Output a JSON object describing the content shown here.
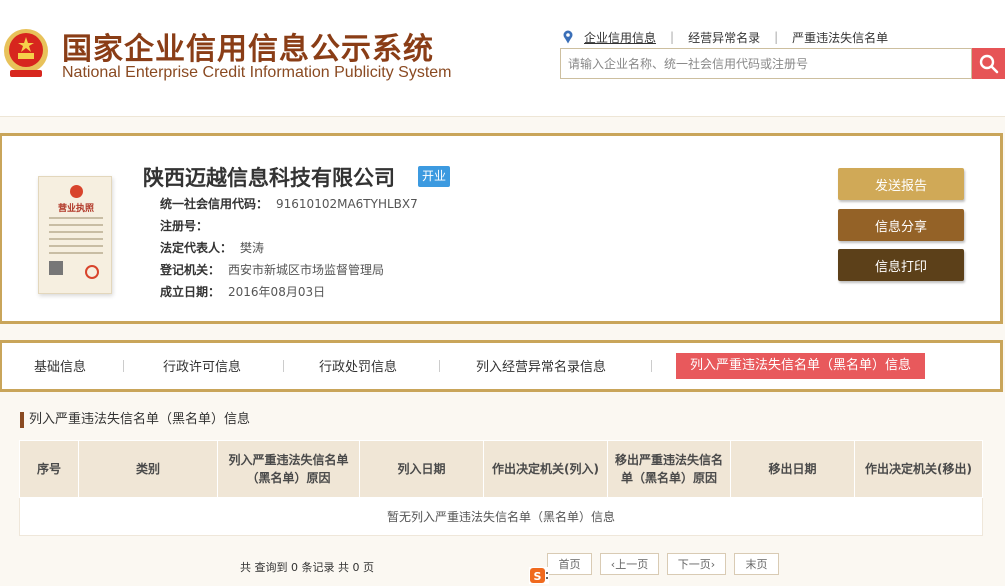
{
  "header": {
    "title_cn": "国家企业信用信息公示系统",
    "title_en": "National Enterprise Credit Information Publicity System",
    "emblem_icon": "national-emblem-icon",
    "nav": [
      {
        "label": "企业信用信息",
        "active": true
      },
      {
        "label": "经营异常名录",
        "active": false
      },
      {
        "label": "严重违法失信名单",
        "active": false
      }
    ],
    "search_placeholder": "请输入企业名称、统一社会信用代码或注册号",
    "search_icon": "search-icon"
  },
  "company": {
    "name": "陕西迈越信息科技有限公司",
    "status": "开业",
    "license_image_title": "营业执照",
    "fields": [
      {
        "label": "统一社会信用代码：",
        "value": "91610102MA6TYHLBX7"
      },
      {
        "label": "注册号：",
        "value": ""
      },
      {
        "label": "法定代表人：",
        "value": "樊涛"
      },
      {
        "label": "登记机关：",
        "value": "西安市新城区市场监督管理局"
      },
      {
        "label": "成立日期：",
        "value": "2016年08月03日"
      }
    ]
  },
  "actions": [
    {
      "label": "发送报告",
      "color": "#d0a957"
    },
    {
      "label": "信息分享",
      "color": "#946227"
    },
    {
      "label": "信息打印",
      "color": "#5c4019"
    }
  ],
  "tabs": [
    {
      "label": "基础信息",
      "active": false
    },
    {
      "label": "行政许可信息",
      "active": false
    },
    {
      "label": "行政处罚信息",
      "active": false
    },
    {
      "label": "列入经营异常名录信息",
      "active": false
    },
    {
      "label": "列入严重违法失信名单（黑名单）信息",
      "active": true
    }
  ],
  "section": {
    "title": "列入严重违法失信名单（黑名单）信息",
    "columns": [
      "序号",
      "类别",
      "列入严重违法失信名单（黑名单）原因",
      "列入日期",
      "作出决定机关(列入)",
      "移出严重违法失信名单（黑名单）原因",
      "移出日期",
      "作出决定机关(移出)"
    ],
    "empty_message": "暂无列入严重违法失信名单（黑名单）信息"
  },
  "pagination": {
    "summary": "共 查询到 0 条记录 共 0 页",
    "buttons": [
      "首页",
      "上一页",
      "下一页",
      "末页"
    ]
  },
  "colors": {
    "brand_brown": "#8a3d16",
    "gold_border": "#c9a55a",
    "active_tab": "#e8595c",
    "status_badge": "#3c9ae0",
    "search_button": "#e65456"
  }
}
